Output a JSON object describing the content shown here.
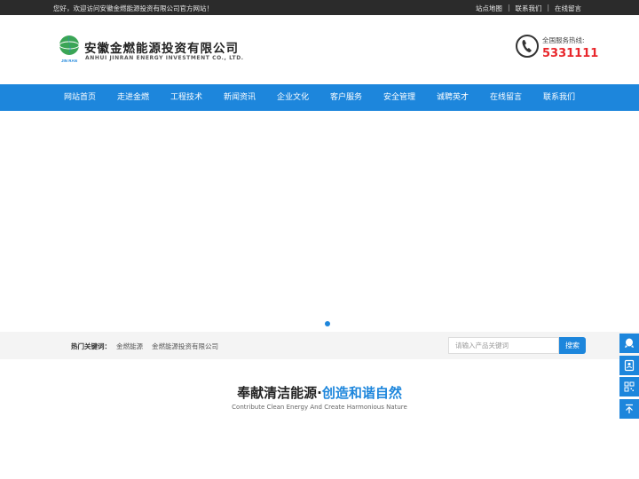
{
  "topbar": {
    "welcome": "您好，欢迎访问安徽金燃能源投资有限公司官方网站！",
    "links": [
      "站点地图",
      "联系我们",
      "在线留言"
    ],
    "separator": "|"
  },
  "header": {
    "logo_text": "JIN RAN",
    "brand_cn": "安徽金燃能源投资有限公司",
    "brand_en": "ANHUI JINRAN ENERGY INVESTMENT CO., LTD.",
    "hotline_label": "全国服务热线:",
    "hotline_number": "5331111"
  },
  "nav": {
    "items": [
      "网站首页",
      "走进金燃",
      "工程技术",
      "新闻资讯",
      "企业文化",
      "客户服务",
      "安全管理",
      "诚聘英才",
      "在线留言",
      "联系我们"
    ]
  },
  "search": {
    "hot_label": "热门关键词：",
    "keywords": [
      "金燃能源",
      "金燃能源投资有限公司"
    ],
    "placeholder": "请输入产品关键词",
    "button": "搜索"
  },
  "slogan": {
    "part1": "奉献清洁能源",
    "dot": "·",
    "part2": "创造和谐自然",
    "english": "Contribute Clean Energy And Create Harmonious Nature"
  },
  "colors": {
    "accent": "#1d86dc",
    "topbar": "#2b2b2b",
    "hotline": "#e8262b"
  },
  "side_icons": [
    "qq-icon",
    "contact-card-icon",
    "qrcode-icon",
    "back-to-top-icon"
  ]
}
